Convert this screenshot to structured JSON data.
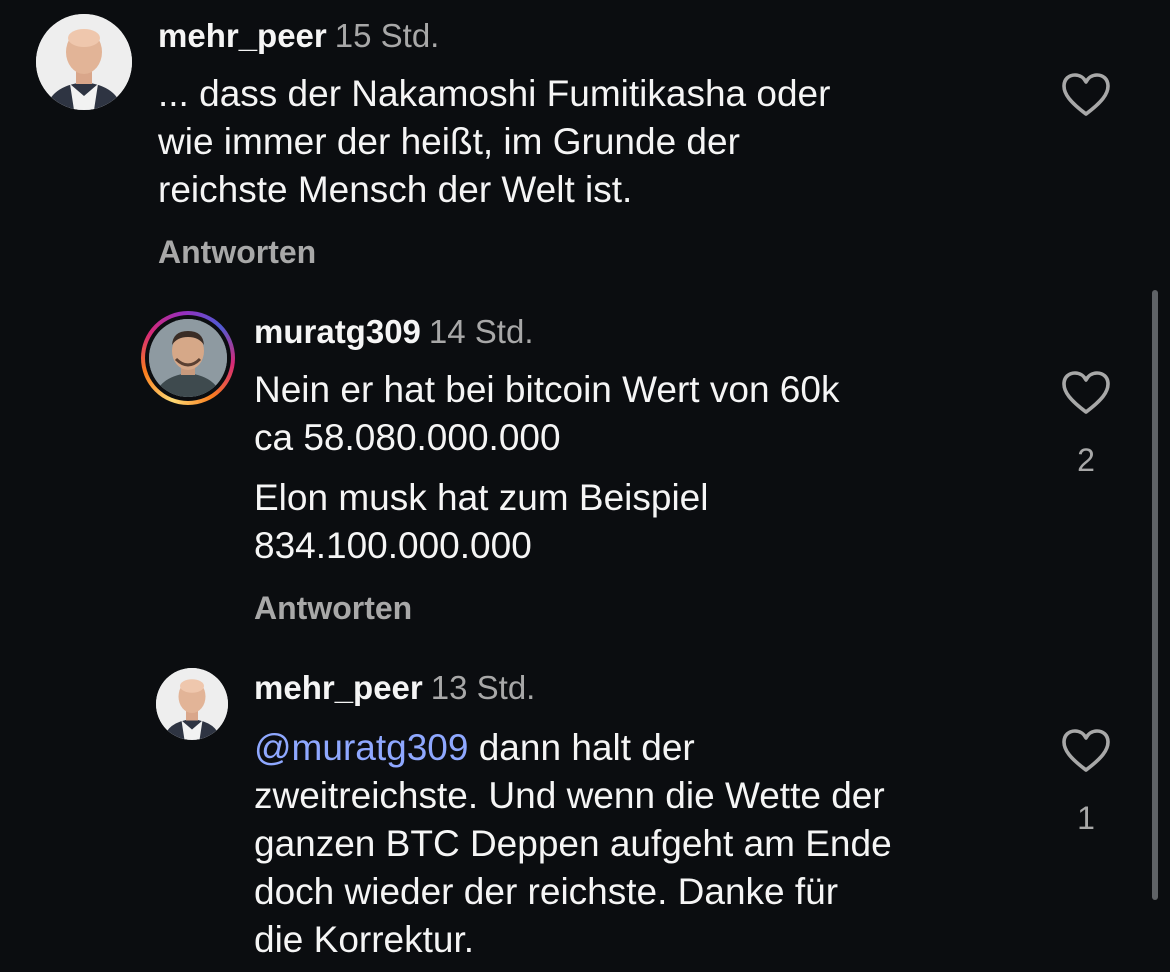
{
  "comments": [
    {
      "username": "mehr_peer",
      "time": "15 Std.",
      "text": "... dass der Nakamoshi Fumitikasha oder\nwie immer der heißt, im Grunde der\nreichste Mensch der Welt ist.",
      "reply_label": "Antworten",
      "avatar_icon": "bald-man-avatar"
    },
    {
      "username": "muratg309",
      "time": "14 Std.",
      "text_1": "Nein er hat bei bitcoin Wert von 60k\nca 58.080.000.000",
      "text_2": "Elon musk hat zum Beispiel\n834.100.000.000",
      "reply_label": "Antworten",
      "likes": "2",
      "avatar_icon": "man-with-story-ring-avatar"
    },
    {
      "username": "mehr_peer",
      "time": "13 Std.",
      "mention": "@muratg309",
      "text": " dann halt der\nzweitreichste. Und wenn die Wette der\nganzen BTC Deppen aufgeht am Ende\ndoch wieder der reichste. Danke für\ndie Korrektur.",
      "likes": "1",
      "avatar_icon": "bald-man-avatar"
    }
  ],
  "colors": {
    "background": "#0b0d10",
    "text": "#f5f5f5",
    "secondary": "#a8a8a8",
    "mention": "#8fa8ff"
  }
}
